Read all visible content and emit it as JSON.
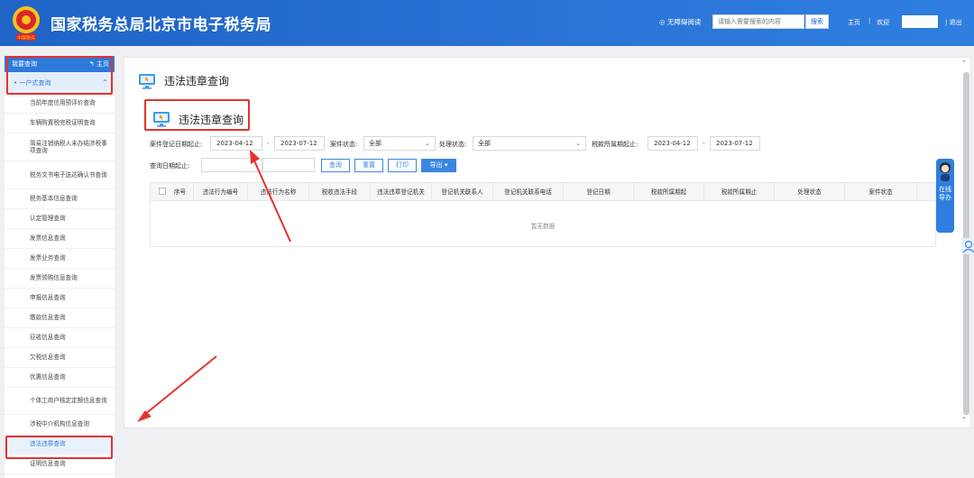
{
  "header": {
    "site_title": "国家税务总局北京市电子税务局",
    "emblem_text": "中国税务",
    "accessibility": "◎ 无障碍阅读",
    "search_placeholder": "请输入需要搜索的内容",
    "search_button": "搜索",
    "home": "主页",
    "sep": "|",
    "welcome": "欢迎",
    "logout": "| 退出"
  },
  "sidebar": {
    "title": "我要查询",
    "home": "主页",
    "group": "一户式查询",
    "items": [
      "当前年度信用预评价查询",
      "车辆购置税完税证明查询",
      "简易注销纳税人未办结涉税事项查询",
      "税务文书电子送达确认书查询",
      "税务基本信息查询",
      "认定管理查询",
      "发票信息查询",
      "发票业务查询",
      "发票领购信息查询",
      "申报信息查询",
      "缴款信息查询",
      "征收信息查询",
      "欠税信息查询",
      "优惠信息查询",
      "个体工商户核定定额信息查询",
      "涉税中介机构信息查询",
      "违法违章查询",
      "证明信息查询"
    ],
    "active_index": 16
  },
  "main": {
    "page_title": "违法违章查询",
    "section_title": "违法违章查询",
    "filters": {
      "case_reg_date_label": "案件登记日期起止:",
      "case_reg_start": "2023-04-12",
      "case_reg_end": "2023-07-12",
      "range_dash": "-",
      "case_status_label": "案件状态:",
      "case_status_value": "全部",
      "process_status_label": "处理状态:",
      "process_status_value": "全部",
      "tax_period_label": "税款所属期起止:",
      "tax_period_start": "2023-04-12",
      "tax_period_end": "2023-07-12",
      "query_date_label": "查询日期起止:"
    },
    "buttons": {
      "query": "查询",
      "reset": "重置",
      "print": "打印",
      "export": "导出 ▾"
    },
    "table": {
      "columns": [
        "序号",
        "违法行为编号",
        "违法行为名称",
        "税收违法手段",
        "违法违章登记机关",
        "登记机关联系人",
        "登记机关联系电话",
        "登记日期",
        "税款所属期起",
        "税款所属期止",
        "处理状态",
        "案件状态"
      ],
      "empty_text": "暂无数据"
    }
  },
  "float": {
    "online_label": "在线导办"
  },
  "colors": {
    "header_blue": "#1f63c6",
    "accent_blue": "#2d7ad8",
    "annotation_red": "#e5322d"
  }
}
